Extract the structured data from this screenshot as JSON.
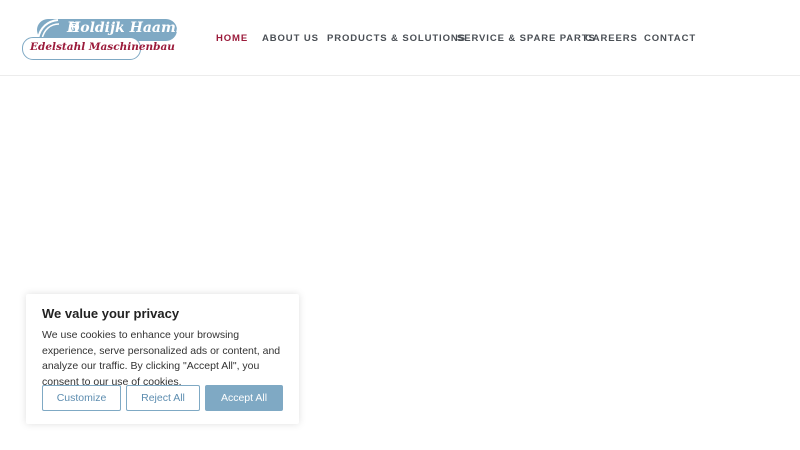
{
  "logo": {
    "brand_name": "Holdijk Haamberg",
    "registered_mark": "®",
    "tagline": "Edelstahl Maschinenbau"
  },
  "nav": {
    "items": [
      {
        "label": "HOME",
        "active": true
      },
      {
        "label": "ABOUT US"
      },
      {
        "label": "PRODUCTS & SOLUTIONS"
      },
      {
        "label": "SERVICE & SPARE PARTS"
      },
      {
        "label": "CAREERS"
      },
      {
        "label": "CONTACT"
      }
    ]
  },
  "cookie_banner": {
    "title": "We value your privacy",
    "body": "We use cookies to enhance your browsing experience, serve personalized ads or content, and analyze our traffic. By clicking \"Accept All\", you consent to our use of cookies.",
    "customize_label": "Customize",
    "reject_label": "Reject All",
    "accept_label": "Accept All"
  },
  "colors": {
    "accent": "#9b1b3b",
    "brand_blue": "#7fa9c4",
    "nav_text": "#4a4f55"
  }
}
